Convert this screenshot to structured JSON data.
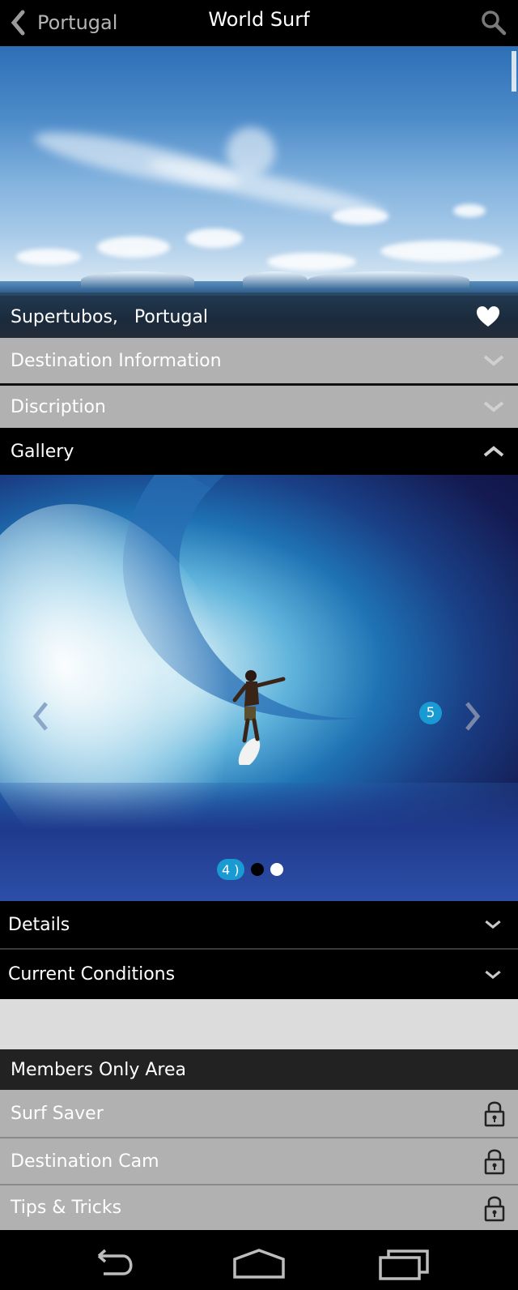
{
  "topbar": {
    "back_label": "Portugal",
    "title": "World Surf",
    "back_icon": "chevron-left-icon",
    "search_icon": "search-icon"
  },
  "hero": {
    "spot": "Supertubos,",
    "country": "Portugal",
    "favorite_icon": "heart-icon"
  },
  "sections": {
    "destination_info": "Destination Information",
    "description": "Discription",
    "gallery": "Gallery",
    "details": "Details",
    "current_conditions": "Current Conditions"
  },
  "gallery": {
    "next_count": "5",
    "current_badge": "4 )",
    "total_dots": 2,
    "active_dot": 0
  },
  "members": {
    "header": "Members Only Area",
    "items": [
      {
        "label": "Surf Saver",
        "icon": "lock-icon"
      },
      {
        "label": "Destination Cam",
        "icon": "lock-icon"
      },
      {
        "label": "Tips & Tricks",
        "icon": "lock-icon"
      }
    ]
  },
  "colors": {
    "accent": "#1a9ad2",
    "row_grey": "#b1b1b1",
    "members_header": "#222222",
    "spacer": "#dcdcdc"
  }
}
